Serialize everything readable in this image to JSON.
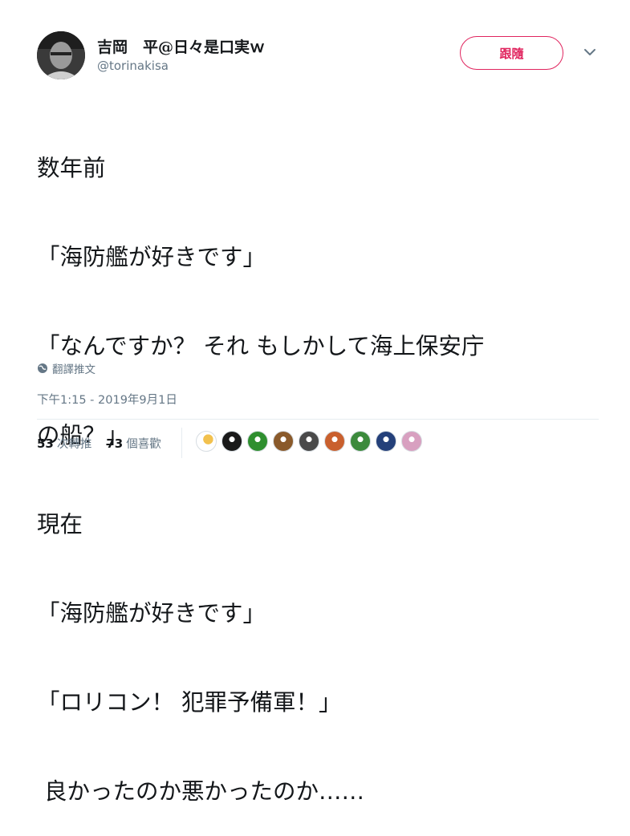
{
  "user": {
    "display_name": "吉岡　平@日々是口実ｗ",
    "handle": "@torinakisa",
    "avatar_icon": "profile-photo"
  },
  "follow_button_label": "跟隨",
  "caret_icon": "chevron-down-icon",
  "tweet": {
    "lines": [
      "数年前",
      "「海防艦が好きです」",
      "「なんですか？ それ もしかして海上保安庁",
      "の船？」",
      "現在",
      "「海防艦が好きです」",
      "「ロリコン！ 犯罪予備軍！」",
      " 良かったのか悪かったのか……"
    ]
  },
  "translate_label": "翻譯推文",
  "timestamp": "下午1:15 - 2019年9月1日",
  "stats": {
    "retweets_count": "53",
    "retweets_label": "次轉推",
    "likes_count": "73",
    "likes_label": "個喜歡"
  },
  "likers": [
    {
      "icon": "liker-avatar-1",
      "color": "#f4f4f4"
    },
    {
      "icon": "liker-avatar-2",
      "color": "#1a1a1a"
    },
    {
      "icon": "liker-avatar-3",
      "color": "#2f8f2f"
    },
    {
      "icon": "liker-avatar-4",
      "color": "#8a5a2b"
    },
    {
      "icon": "liker-avatar-5",
      "color": "#4a4a4a"
    },
    {
      "icon": "liker-avatar-6",
      "color": "#c9602e"
    },
    {
      "icon": "liker-avatar-7",
      "color": "#3c8a3c"
    },
    {
      "icon": "liker-avatar-8",
      "color": "#24407a"
    },
    {
      "icon": "liker-avatar-9",
      "color": "#d8a0c0"
    }
  ],
  "colors": {
    "accent": "#e0245e",
    "secondary_text": "#657786",
    "primary_text": "#14171a"
  }
}
